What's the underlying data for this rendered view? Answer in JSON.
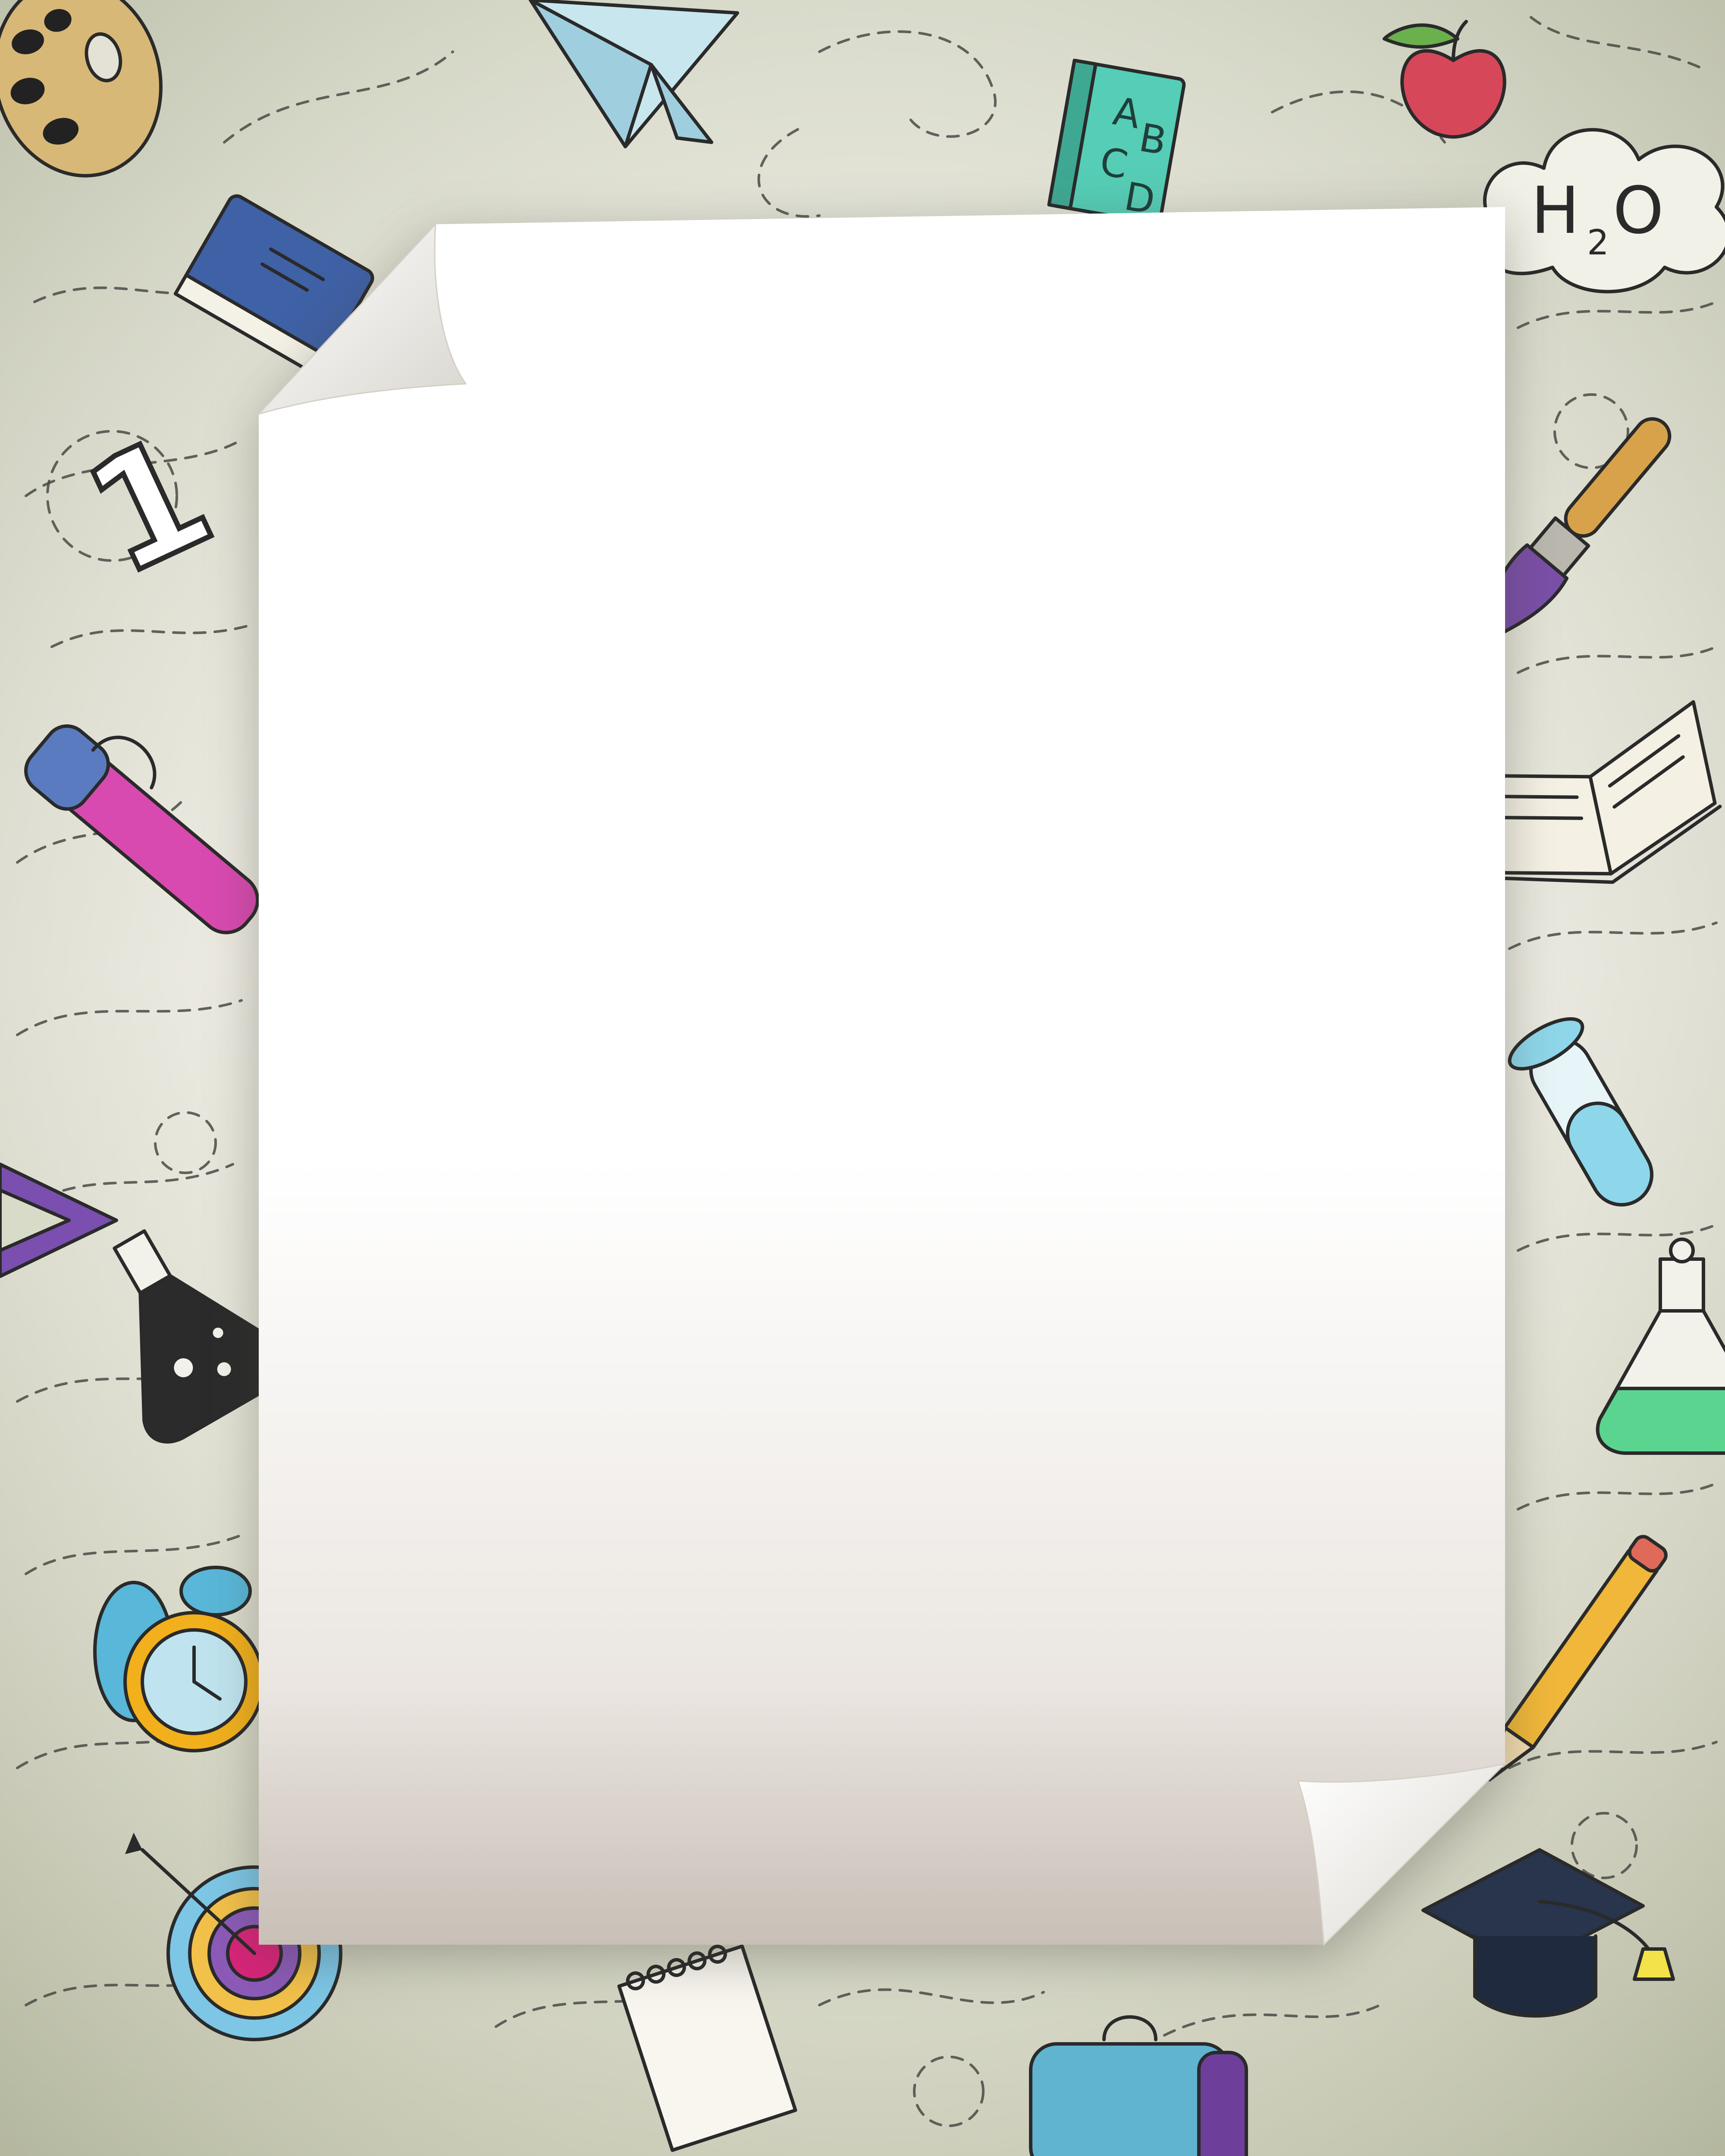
{
  "scene": {
    "background": {
      "top_color": "#d9dbc9",
      "mid_color": "#e4e2d6",
      "bottom_color": "#c9cbb3"
    },
    "paper": {
      "color": "#ffffff",
      "shade_color": "#c8bfb6"
    },
    "doodles": {
      "h2o_label": "H",
      "h2o_sub": "2",
      "h2o_tail": "O",
      "number_one": "1",
      "book_letters": [
        "A",
        "B",
        "C",
        "D"
      ]
    },
    "colors": {
      "blue_book": "#3f61a6",
      "teal_book": "#56cdb6",
      "apple": "#d6475a",
      "paintbrush_tip": "#7a4fa8",
      "pen_pink": "#d84ab0",
      "pen_grip": "#5a7bbf",
      "triangle_ruler": "#7a4fb0",
      "flask_dark": "#2b2b2b",
      "flask_green": "#5bd48f",
      "test_tube": "#8ed6ea",
      "clock_blue": "#59b7d9",
      "clock_yellow": "#f2b01c",
      "pencil": "#f0b73a",
      "grad_cap": "#28354d",
      "tassel": "#f4e24a",
      "target_pink": "#d8247a",
      "target_blue": "#7dc6e6",
      "bag_blue": "#60b4d0",
      "bag_purple": "#6d3f9a"
    }
  }
}
